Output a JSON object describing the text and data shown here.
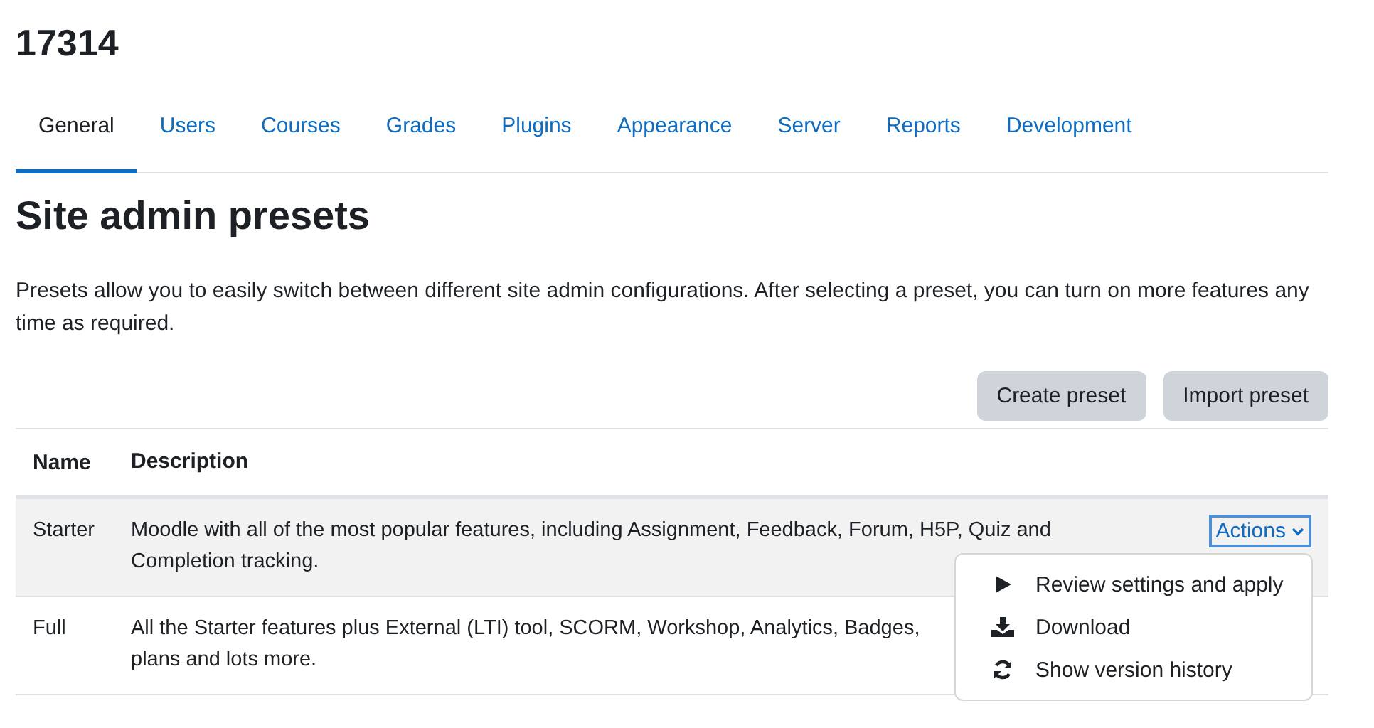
{
  "page_title": "17314",
  "tabs": [
    {
      "label": "General",
      "selected": true
    },
    {
      "label": "Users",
      "selected": false
    },
    {
      "label": "Courses",
      "selected": false
    },
    {
      "label": "Grades",
      "selected": false
    },
    {
      "label": "Plugins",
      "selected": false
    },
    {
      "label": "Appearance",
      "selected": false
    },
    {
      "label": "Server",
      "selected": false
    },
    {
      "label": "Reports",
      "selected": false
    },
    {
      "label": "Development",
      "selected": false
    }
  ],
  "heading": "Site admin presets",
  "intro": "Presets allow you to easily switch between different site admin configurations. After selecting a preset, you can turn on more features any time as required.",
  "buttons": [
    "Create preset",
    "Import preset"
  ],
  "table": {
    "columns": [
      "Name",
      "Description"
    ],
    "rows": [
      {
        "name": "Starter",
        "description_lines": [
          "Moodle with all of the most popular features, including Assignment, Feedback, Forum, H5P, Quiz and",
          "Completion tracking."
        ],
        "actions": "Actions",
        "highlighted": true
      },
      {
        "name": "Full",
        "description_lines": [
          "All the Starter features plus External (LTI) tool, SCORM, Workshop, Analytics, Badges,",
          "plans and lots more."
        ],
        "highlighted": false
      }
    ]
  },
  "actions_menu": {
    "items": [
      {
        "kind": "play",
        "label": "Review settings and apply"
      },
      {
        "kind": "download",
        "label": "Download"
      },
      {
        "kind": "history",
        "label": "Show version history"
      }
    ]
  }
}
